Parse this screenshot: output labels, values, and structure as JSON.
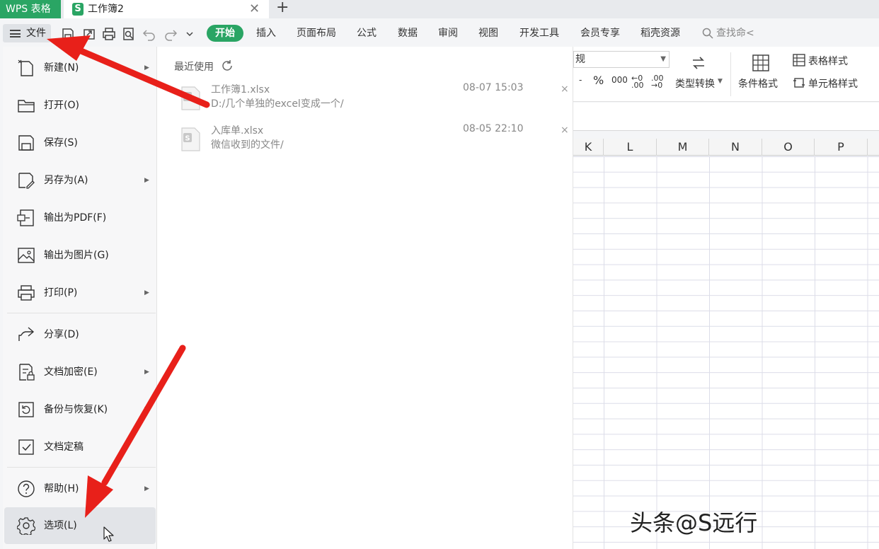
{
  "titlebar": {
    "app_tab": "WPS 表格",
    "doc_tab_icon": "S",
    "doc_tab": "工作簿2",
    "close_glyph": "✕",
    "new_tab_glyph": "+"
  },
  "toolbar": {
    "file_label": "文件",
    "quick_icons": [
      "save-icon",
      "export-icon",
      "print-icon",
      "print-preview-icon",
      "undo-icon",
      "redo-icon",
      "more-dropdown-icon"
    ],
    "tabs": [
      "开始",
      "插入",
      "页面布局",
      "公式",
      "数据",
      "审阅",
      "视图",
      "开发工具",
      "会员专享",
      "稻壳资源"
    ],
    "active_tab": "开始",
    "search_label": "查找命<"
  },
  "ribbon": {
    "number_format_value": "规",
    "number_row": [
      "-",
      "%",
      "000",
      "←0 .00",
      ".00 →0"
    ],
    "type_convert": "类型转换",
    "conditional_format": "条件格式",
    "table_style": "表格样式",
    "cell_style": "单元格样式"
  },
  "sheet": {
    "columns": [
      "K",
      "L",
      "M",
      "N",
      "O",
      "P"
    ]
  },
  "file_menu": {
    "items": [
      {
        "label": "新建(N)",
        "icon": "new-file-icon",
        "submenu": true
      },
      {
        "label": "打开(O)",
        "icon": "folder-open-icon",
        "submenu": false
      },
      {
        "label": "保存(S)",
        "icon": "save-icon",
        "submenu": false
      },
      {
        "label": "另存为(A)",
        "icon": "save-as-icon",
        "submenu": true
      },
      {
        "label": "输出为PDF(F)",
        "icon": "pdf-export-icon",
        "submenu": false
      },
      {
        "label": "输出为图片(G)",
        "icon": "image-export-icon",
        "submenu": false
      },
      {
        "label": "打印(P)",
        "icon": "print-icon",
        "submenu": true
      },
      {
        "label": "分享(D)",
        "icon": "share-icon",
        "submenu": false
      },
      {
        "label": "文档加密(E)",
        "icon": "encrypt-icon",
        "submenu": true
      },
      {
        "label": "备份与恢复(K)",
        "icon": "backup-icon",
        "submenu": true
      },
      {
        "label": "文档定稿",
        "icon": "finalize-icon",
        "submenu": false
      },
      {
        "label": "帮助(H)",
        "icon": "help-icon",
        "submenu": true
      },
      {
        "label": "选项(L)",
        "icon": "gear-icon",
        "submenu": false,
        "selected": true
      }
    ],
    "submenu_glyph": "▶"
  },
  "recent": {
    "title": "最近使用",
    "files": [
      {
        "name": "工作簿1.xlsx",
        "path": "D:/几个单独的excel变成一个/",
        "time": "08-07 15:03"
      },
      {
        "name": "入库单.xlsx",
        "path": "微信收到的文件/",
        "time": "08-05 22:10"
      }
    ],
    "remove_glyph": "×"
  },
  "watermark": "头条@S远行",
  "colors": {
    "brand_green": "#2aa564",
    "arrow_red": "#e8201a"
  }
}
